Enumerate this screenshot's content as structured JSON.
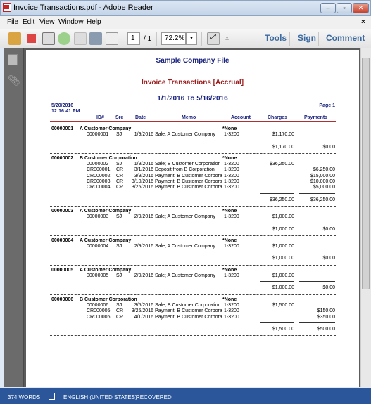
{
  "window": {
    "title": "Invoice Transactions.pdf - Adobe Reader"
  },
  "menu": [
    "File",
    "Edit",
    "View",
    "Window",
    "Help"
  ],
  "toolbar": {
    "page": "1",
    "page_total": "/ 1",
    "zoom": "72.2%",
    "tools": "Tools",
    "sign": "Sign",
    "comment": "Comment"
  },
  "report": {
    "company": "Sample Company File",
    "title": "Invoice Transactions [Accrual]",
    "range": "1/1/2016 To 5/16/2016",
    "date": "5/20/2016",
    "time": "12:16:41 PM",
    "page": "Page 1",
    "columns": [
      "ID#",
      "Src",
      "Date",
      "Memo",
      "Account",
      "Charges",
      "Payments"
    ],
    "groups": [
      {
        "id": "00000001",
        "name": "A Customer Company",
        "account": "*None",
        "tx": [
          [
            "00000001",
            "SJ",
            "1/9/2016",
            "Sale; A Customer Company",
            "1-3200",
            "$1,170.00",
            ""
          ]
        ],
        "charges": "$1,170.00",
        "payments": "$0.00"
      },
      {
        "id": "00000002",
        "name": "B Customer Corporation",
        "account": "*None",
        "tx": [
          [
            "00000002",
            "SJ",
            "1/9/2016",
            "Sale; B Customer Corporation",
            "1-3200",
            "$36,250.00",
            ""
          ],
          [
            "CR000001",
            "CR",
            "3/1/2016",
            "Deposit from B Corporation",
            "1-3200",
            "",
            "$6,250.00"
          ],
          [
            "CR000002",
            "CR",
            "3/9/2016",
            "Payment; B Customer Corpora",
            "1-3200",
            "",
            "$15,000.00"
          ],
          [
            "CR000003",
            "CR",
            "3/10/2016",
            "Payment; B Customer Corpora",
            "1-3200",
            "",
            "$10,000.00"
          ],
          [
            "CR000004",
            "CR",
            "3/25/2016",
            "Payment; B Customer Corpora",
            "1-3200",
            "",
            "$5,000.00"
          ]
        ],
        "charges": "$36,250.00",
        "payments": "$36,250.00"
      },
      {
        "id": "00000003",
        "name": "A Customer Company",
        "account": "*None",
        "tx": [
          [
            "00000003",
            "SJ",
            "2/9/2016",
            "Sale; A Customer Company",
            "1-3200",
            "$1,000.00",
            ""
          ]
        ],
        "charges": "$1,000.00",
        "payments": "$0.00"
      },
      {
        "id": "00000004",
        "name": "A Customer Company",
        "account": "*None",
        "tx": [
          [
            "00000004",
            "SJ",
            "2/9/2016",
            "Sale; A Customer Company",
            "1-3200",
            "$1,000.00",
            ""
          ]
        ],
        "charges": "$1,000.00",
        "payments": "$0.00"
      },
      {
        "id": "00000005",
        "name": "A Customer Company",
        "account": "*None",
        "tx": [
          [
            "00000005",
            "SJ",
            "2/9/2016",
            "Sale; A Customer Company",
            "1-3200",
            "$1,000.00",
            ""
          ]
        ],
        "charges": "$1,000.00",
        "payments": "$0.00"
      },
      {
        "id": "00000006",
        "name": "B Customer Corporation",
        "account": "*None",
        "tx": [
          [
            "00000006",
            "SJ",
            "3/5/2016",
            "Sale; B Customer Corporation",
            "1-3200",
            "$1,500.00",
            ""
          ],
          [
            "CR000005",
            "CR",
            "3/25/2016",
            "Payment; B Customer Corpora",
            "1-3200",
            "",
            "$150.00"
          ],
          [
            "CR000006",
            "CR",
            "4/1/2016",
            "Payment; B Customer Corpora",
            "1-3200",
            "",
            "$350.00"
          ]
        ],
        "charges": "$1,500.00",
        "payments": "$500.00"
      }
    ]
  },
  "status": {
    "words": "374 WORDS",
    "language": "ENGLISH (UNITED STATES)",
    "state": "RECOVERED"
  },
  "colors": {
    "navy": "#1a237e",
    "title_red": "#9b1c1c",
    "rule_red": "#b03030",
    "status_bar": "#2b579a"
  }
}
